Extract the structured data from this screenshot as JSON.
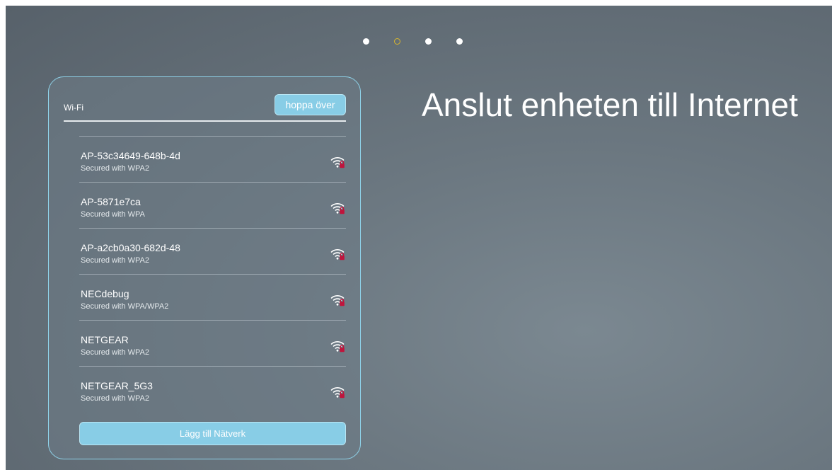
{
  "pager": {
    "dots": [
      "inactive",
      "active",
      "inactive",
      "inactive"
    ],
    "active_index": 1,
    "colors": {
      "dot": "#ffffff",
      "active_ring": "#d8b62e"
    }
  },
  "panel": {
    "title": "Wi-Fi",
    "skip_label": "hoppa över",
    "networks": [
      {
        "name": "AP-53c34649-648b-4d",
        "security": "Secured with WPA2",
        "icon": "wifi-locked-icon"
      },
      {
        "name": "AP-5871e7ca",
        "security": "Secured with WPA",
        "icon": "wifi-locked-icon"
      },
      {
        "name": "AP-a2cb0a30-682d-48",
        "security": "Secured with WPA2",
        "icon": "wifi-locked-icon"
      },
      {
        "name": "NECdebug",
        "security": "Secured with WPA/WPA2",
        "icon": "wifi-locked-icon"
      },
      {
        "name": "NETGEAR",
        "security": "Secured with WPA2",
        "icon": "wifi-locked-icon"
      },
      {
        "name": "NETGEAR_5G3",
        "security": "Secured with WPA2",
        "icon": "wifi-locked-icon"
      }
    ],
    "add_network_label": "Lägg till Nätverk",
    "colors": {
      "accent": "#88cde6",
      "border": "#8fd3ea",
      "lock": "#c0143c"
    }
  },
  "heading": "Anslut enheten till Internet"
}
